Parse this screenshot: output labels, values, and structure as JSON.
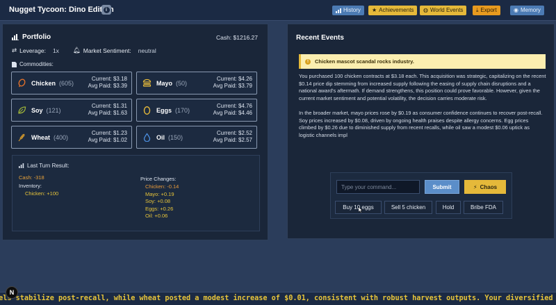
{
  "header": {
    "title": "Nugget Tycoon: Dino Edition",
    "nav": {
      "history": "History",
      "achievements": "Achievements",
      "world_events": "World Events",
      "export": "Export",
      "memory": "Memory"
    }
  },
  "portfolio": {
    "title": "Portfolio",
    "cash": "Cash: $1216.27",
    "leverage_label": "Leverage:",
    "leverage_value": "1x",
    "sentiment_label": "Market Sentiment:",
    "sentiment_value": "neutral",
    "commodities_label": "Commodities:",
    "commodities": [
      {
        "name": "Chicken",
        "qty": "(605)",
        "current": "Current: $3.18",
        "avg": "Avg Paid: $3.39",
        "icon": "drumstick-icon"
      },
      {
        "name": "Mayo",
        "qty": "(50)",
        "current": "Current: $4.26",
        "avg": "Avg Paid: $3.79",
        "icon": "burger-icon"
      },
      {
        "name": "Soy",
        "qty": "(121)",
        "current": "Current: $1.31",
        "avg": "Avg Paid: $1.63",
        "icon": "leaf-icon"
      },
      {
        "name": "Eggs",
        "qty": "(170)",
        "current": "Current: $4.76",
        "avg": "Avg Paid: $4.46",
        "icon": "egg-icon"
      },
      {
        "name": "Wheat",
        "qty": "(400)",
        "current": "Current: $1.23",
        "avg": "Avg Paid: $1.02",
        "icon": "wheat-icon"
      },
      {
        "name": "Oil",
        "qty": "(150)",
        "current": "Current: $2.52",
        "avg": "Avg Paid: $2.57",
        "icon": "oil-drop-icon"
      }
    ],
    "last_turn": {
      "title": "Last Turn Result:",
      "cash": "Cash: -318",
      "inventory_label": "Inventory:",
      "inventory_item": "Chicken: +100",
      "price_changes_label": "Price Changes:",
      "price_changes": [
        "Chicken: -0.14",
        "Mayo: +0.19",
        "Soy: +0.08",
        "Eggs: +0.26",
        "Oil: +0.06"
      ]
    }
  },
  "events": {
    "title": "Recent Events",
    "alert": "Chicken mascot scandal rocks industry.",
    "paragraph1": "You purchased 100 chicken contracts at $3.18 each. This acquisition was strategic, capitalizing on the recent $0.14 price dip stemming from increased supply following the easing of supply chain disruptions and a national award's aftermath. If demand strengthens, this position could prove favorable. However, given the current market sentiment and potential volatility, the decision carries moderate risk.",
    "paragraph2": "In the broader market, mayo prices rose by $0.19 as consumer confidence continues to recover post-recall. Soy prices increased by $0.08, driven by ongoing health praises despite allergy concerns. Egg prices climbed by $0.26 due to diminished supply from recent recalls, while oil saw a modest $0.06 uptick as logistic channels impl"
  },
  "command": {
    "placeholder": "Type your command...",
    "submit": "Submit",
    "chaos": "Chaos",
    "quick": [
      "Buy 10 eggs",
      "Sell 5 chicken",
      "Hold",
      "Bribe FDA"
    ]
  },
  "ticker": "vels stabilize post-recall, while wheat posted a modest increase of $0.01, consistent with robust harvest outputs. Your diversified portfolio cou",
  "badge": "N"
}
